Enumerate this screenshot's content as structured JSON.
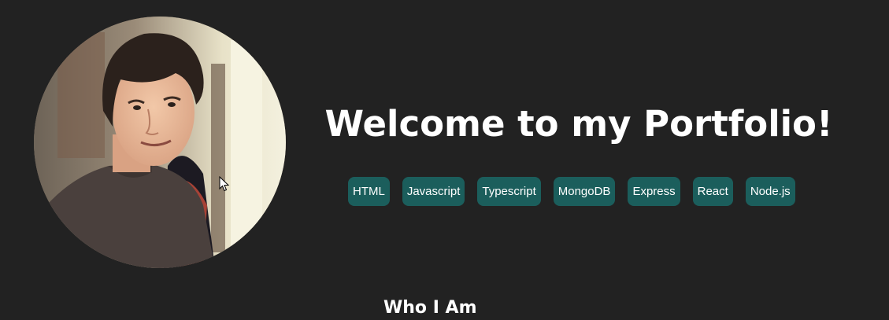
{
  "hero": {
    "title": "Welcome to my Portfolio!",
    "avatar_description": "circular portrait photo",
    "tags": [
      "HTML",
      "Javascript",
      "Typescript",
      "MongoDB",
      "Express",
      "React",
      "Node.js"
    ]
  },
  "about": {
    "heading": "Who I Am"
  },
  "colors": {
    "background": "#222222",
    "tag_background": "#1b5e5c",
    "text": "#ffffff"
  },
  "icons": {
    "cursor": "mouse-pointer-icon"
  }
}
